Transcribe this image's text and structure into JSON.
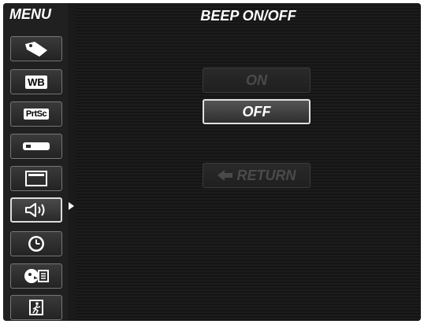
{
  "sidebar": {
    "title": "MENU",
    "items": [
      {
        "icon": "tag-icon"
      },
      {
        "icon": "wb-icon",
        "label": "WB"
      },
      {
        "icon": "prtsc-icon",
        "label": "PrtSc"
      },
      {
        "icon": "usb-drive-icon"
      },
      {
        "icon": "display-icon"
      },
      {
        "icon": "speaker-icon",
        "selected": true
      },
      {
        "icon": "clock-icon"
      },
      {
        "icon": "language-icon"
      },
      {
        "icon": "exit-icon"
      }
    ]
  },
  "main": {
    "title": "BEEP ON/OFF",
    "options": [
      {
        "label": "ON",
        "state": "dim"
      },
      {
        "label": "OFF",
        "state": "active"
      }
    ],
    "return_label": "RETURN"
  }
}
